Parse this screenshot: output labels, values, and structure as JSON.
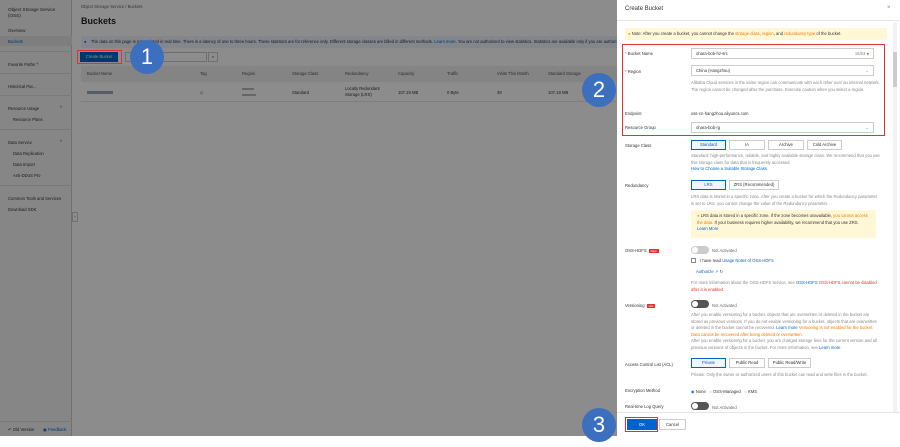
{
  "sidebar": {
    "title": "Object Storage Service (OSS)",
    "items": [
      {
        "label": "Overview"
      },
      {
        "label": "Buckets",
        "active": true
      },
      {
        "label": "Favorite Paths"
      },
      {
        "label": "Historical Pat..."
      },
      {
        "label": "Resource Usage"
      },
      {
        "label": "Resource Plans"
      },
      {
        "label": "Data Service"
      },
      {
        "label": "Data Replication"
      },
      {
        "label": "Data Import"
      },
      {
        "label": "Anti-DDoS Pro"
      },
      {
        "label": "Common Tools and Services"
      },
      {
        "label": "Download SDK"
      }
    ],
    "footer": {
      "old_version": "Old Version",
      "feedback": "Feedback"
    }
  },
  "main": {
    "breadcrumb": [
      "Object Storage Service",
      "Buckets"
    ],
    "title": "Buckets",
    "info": "The data on this page is not updated in real time. There is a latency of one to three hours. These statistics are for reference only. Different storage classes are billed in different methods.",
    "info_link": "Learn more.",
    "info_tail": "You are not authorized to view statistics. Statistics are available only if you are authori",
    "create_button": "Create Bucket",
    "table": {
      "columns": [
        "Bucket Name",
        "Tag",
        "Region",
        "Storage Class",
        "Redundancy",
        "Capacity",
        "Traffic",
        "Visits This Month",
        "Standard Storage"
      ],
      "rows": [
        {
          "storage_class": "Standard",
          "redundancy": "Locally Redundant Storage (LRS)",
          "capacity": "107.19 MB",
          "traffic": "0 Byte",
          "visits": "39",
          "standard_storage": "107.19 MB"
        }
      ]
    }
  },
  "drawer": {
    "title": "Create Bucket",
    "note_prefix": "Note: After you create a bucket, you cannot change the",
    "note_storage": "storage class",
    "note_region": "region",
    "note_and": ", and",
    "note_redundancy": "redundancy type",
    "note_suffix": "of the bucket.",
    "bucket_name": {
      "label": "Bucket Name",
      "value": "ohara-bob-hz-src",
      "counter": "16/63"
    },
    "region": {
      "label": "Region",
      "value": "China (Hangzhou)",
      "help": "Alibaba Cloud services in the same region can communicate with each other over an internal network. The region cannot be changed after the purchase. Exercise caution when you select a region."
    },
    "endpoint": {
      "label": "Endpoint",
      "value": "oss-cn-hangzhou.aliyuncs.com"
    },
    "resource_group": {
      "label": "Resource Group",
      "value": "ohara-bob-rg"
    },
    "storage_class": {
      "label": "Storage Class",
      "options": [
        "Standard",
        "IA",
        "Archive",
        "Cold Archive"
      ],
      "selected": "Standard",
      "help": "Standard: high-performance, reliable, and highly available storage class. We recommend that you use this storage class for data that is frequently accessed.",
      "link": "How to Choose a Suitable Storage Class"
    },
    "redundancy": {
      "label": "Redundancy",
      "options": [
        "LRS",
        "ZRS (Recommended)"
      ],
      "selected": "LRS",
      "help": "LRS data is stored in a specific zone. After you create a bucket for which the Redundancy parameter is set to LRS, you cannot change the value of the Redundancy parameter.",
      "warn_a": "LRS data is stored in a specific zone. If the zone becomes unavailable,",
      "warn_b": "you cannot access the data.",
      "warn_c": "If your business requires higher availability, we recommend that you use ZRS.",
      "warn_link": "Learn More"
    },
    "hdfs": {
      "label": "OSS-HDFS",
      "badge": "New",
      "status": "Not Activated",
      "checkbox": "I have read",
      "checkbox_link": "Usage Notes of OSS-HDFS",
      "authorize": "Authorize",
      "info": "For more information about the OSS-HDFS service, see",
      "info_link": "OSS-HDFS",
      "info_err": "OSS-HDFS cannot be disabled after it is enabled."
    },
    "versioning": {
      "label": "Versioning",
      "badge": "Hot",
      "status": "Not Activated",
      "help1": "After you enable versioning for a bucket, objects that are overwritten or deleted in the bucket are stored as previous versions. If you do not enable versioning for a bucket, objects that are overwritten or deleted in the bucket cannot be recovered.",
      "link1": "Learn more",
      "warn": "Versioning is not enabled for the bucket. Data cannot be recovered after being deleted or overwritten.",
      "help2": "After you enable versioning for a bucket, you are charged storage fees for the current version and all previous versions of objects in the bucket. For more information, see",
      "link2": "Learn more"
    },
    "acl": {
      "label": "Access Control List (ACL)",
      "options": [
        "Private",
        "Public Read",
        "Public Read/Write"
      ],
      "selected": "Private",
      "help": "Private: Only the owner or authorized users of this bucket can read and write files in the bucket."
    },
    "encryption": {
      "label": "Encryption Method",
      "options": [
        "None",
        "OSS-Managed",
        "KMS"
      ],
      "selected": "None"
    },
    "log_query": {
      "label": "Real-time Log Query",
      "status": "Not Activated"
    },
    "ok": "OK",
    "cancel": "Cancel"
  },
  "steps": [
    "1",
    "2",
    "3"
  ],
  "colors": {
    "primary": "#0064c8",
    "highlight": "#e5302e",
    "step": "#3c6fbe",
    "warning_bg": "#fff7d6"
  }
}
